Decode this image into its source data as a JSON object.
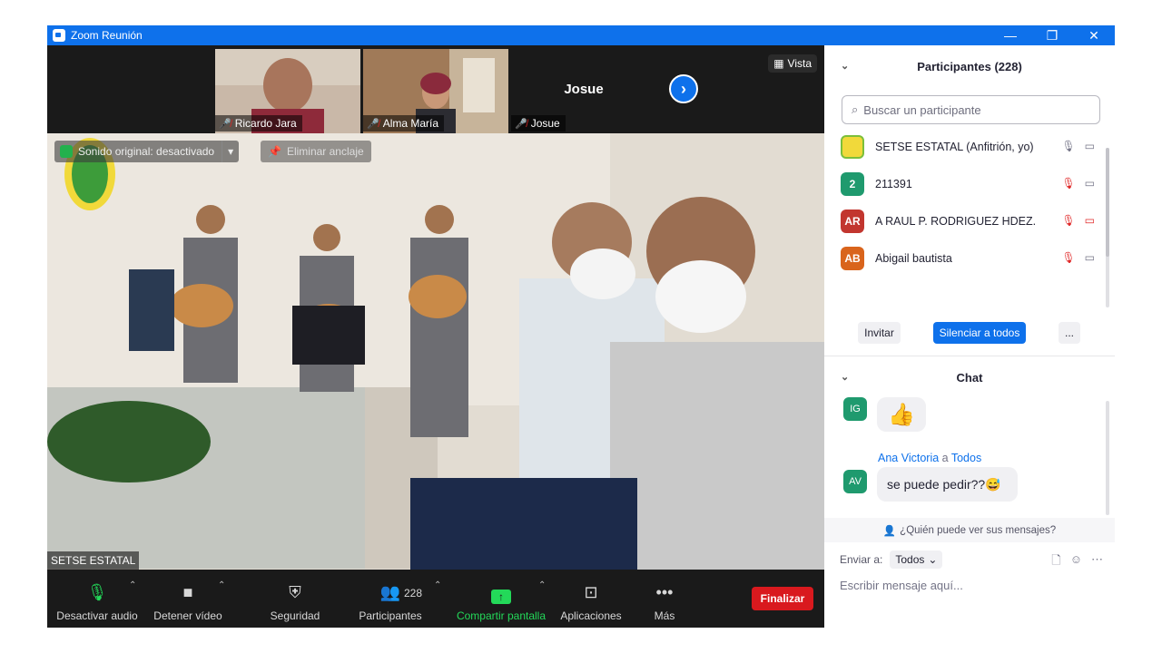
{
  "window": {
    "title": "Zoom Reunión",
    "minimize": "—",
    "restore": "❐",
    "close": "✕"
  },
  "strip": {
    "tiles": [
      {
        "name": "Ricardo Jara"
      },
      {
        "name": "Alma María"
      },
      {
        "name": "Josue",
        "center_label": "Josue"
      }
    ],
    "vista_label": "Vista"
  },
  "main_video": {
    "sound_label": "Sonido original: desactivado",
    "unpin_label": "Eliminar anclaje",
    "speaker_name": "SETSE ESTATAL"
  },
  "toolbar": {
    "audio_label": "Desactivar audio",
    "video_label": "Detener vídeo",
    "security_label": "Seguridad",
    "participants_label": "Participantes",
    "participants_count": "228",
    "share_label": "Compartir pantalla",
    "apps_label": "Aplicaciones",
    "more_label": "Más",
    "end_label": "Finalizar"
  },
  "participants": {
    "header": "Participantes (228)",
    "search_placeholder": "Buscar un participante",
    "list": [
      {
        "initials": "",
        "name": "SETSE ESTATAL (Anfitrión, yo)",
        "color": "#7bbf3a"
      },
      {
        "initials": "2",
        "name": "211391",
        "color": "#1f9a6e"
      },
      {
        "initials": "AR",
        "name": "A RAUL P. RODRIGUEZ HDEZ.",
        "color": "#c2362f"
      },
      {
        "initials": "AB",
        "name": "Abigail bautista",
        "color": "#d9641c"
      }
    ],
    "invite_label": "Invitar",
    "mute_all_label": "Silenciar a todos",
    "more_label": "..."
  },
  "chat": {
    "header": "Chat",
    "messages": [
      {
        "initials": "IG",
        "text": "👍"
      },
      {
        "initials": "AV",
        "sender": "Ana Victoria",
        "to_word": "a",
        "recipient": "Todos",
        "text": "se puede pedir??😅"
      }
    ],
    "privacy_label": "¿Quién puede ver sus mensajes?",
    "send_to_label": "Enviar a:",
    "send_to_value": "Todos",
    "input_placeholder": "Escribir mensaje aquí..."
  }
}
